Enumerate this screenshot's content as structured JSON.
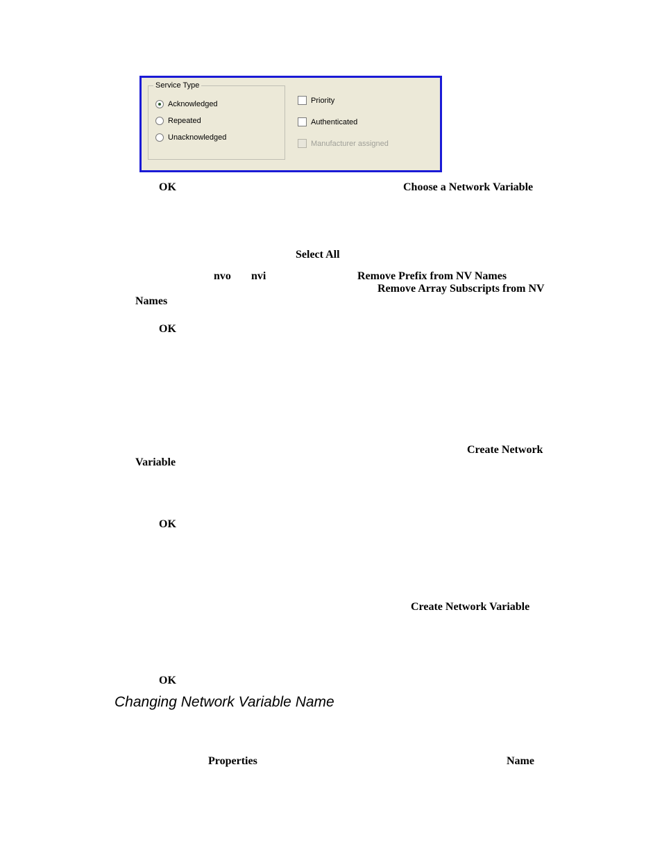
{
  "dialog": {
    "serviceType": {
      "legend": "Service Type",
      "options": [
        {
          "label": "Acknowledged",
          "selected": true
        },
        {
          "label": "Repeated",
          "selected": false
        },
        {
          "label": "Unacknowledged",
          "selected": false
        }
      ]
    },
    "checkboxes": [
      {
        "label": "Priority",
        "checked": false,
        "disabled": false
      },
      {
        "label": "Authenticated",
        "checked": false,
        "disabled": false
      },
      {
        "label": "Manufacturer assigned",
        "checked": false,
        "disabled": true
      }
    ]
  },
  "doc": {
    "ok1": "OK",
    "choose_nv": "Choose a Network Variable",
    "select_all": "Select All",
    "nvo": "nvo",
    "nvi": "nvi",
    "remove_prefix": "Remove Prefix from NV Names",
    "remove_subs": "Remove Array Subscripts from NV",
    "names": "Names",
    "ok2": "OK",
    "create_network": "Create Network",
    "variable": "Variable",
    "ok3": "OK",
    "create_nv": "Create Network Variable",
    "ok4": "OK",
    "heading": "Changing Network Variable Name",
    "properties": "Properties",
    "name": "Name"
  }
}
